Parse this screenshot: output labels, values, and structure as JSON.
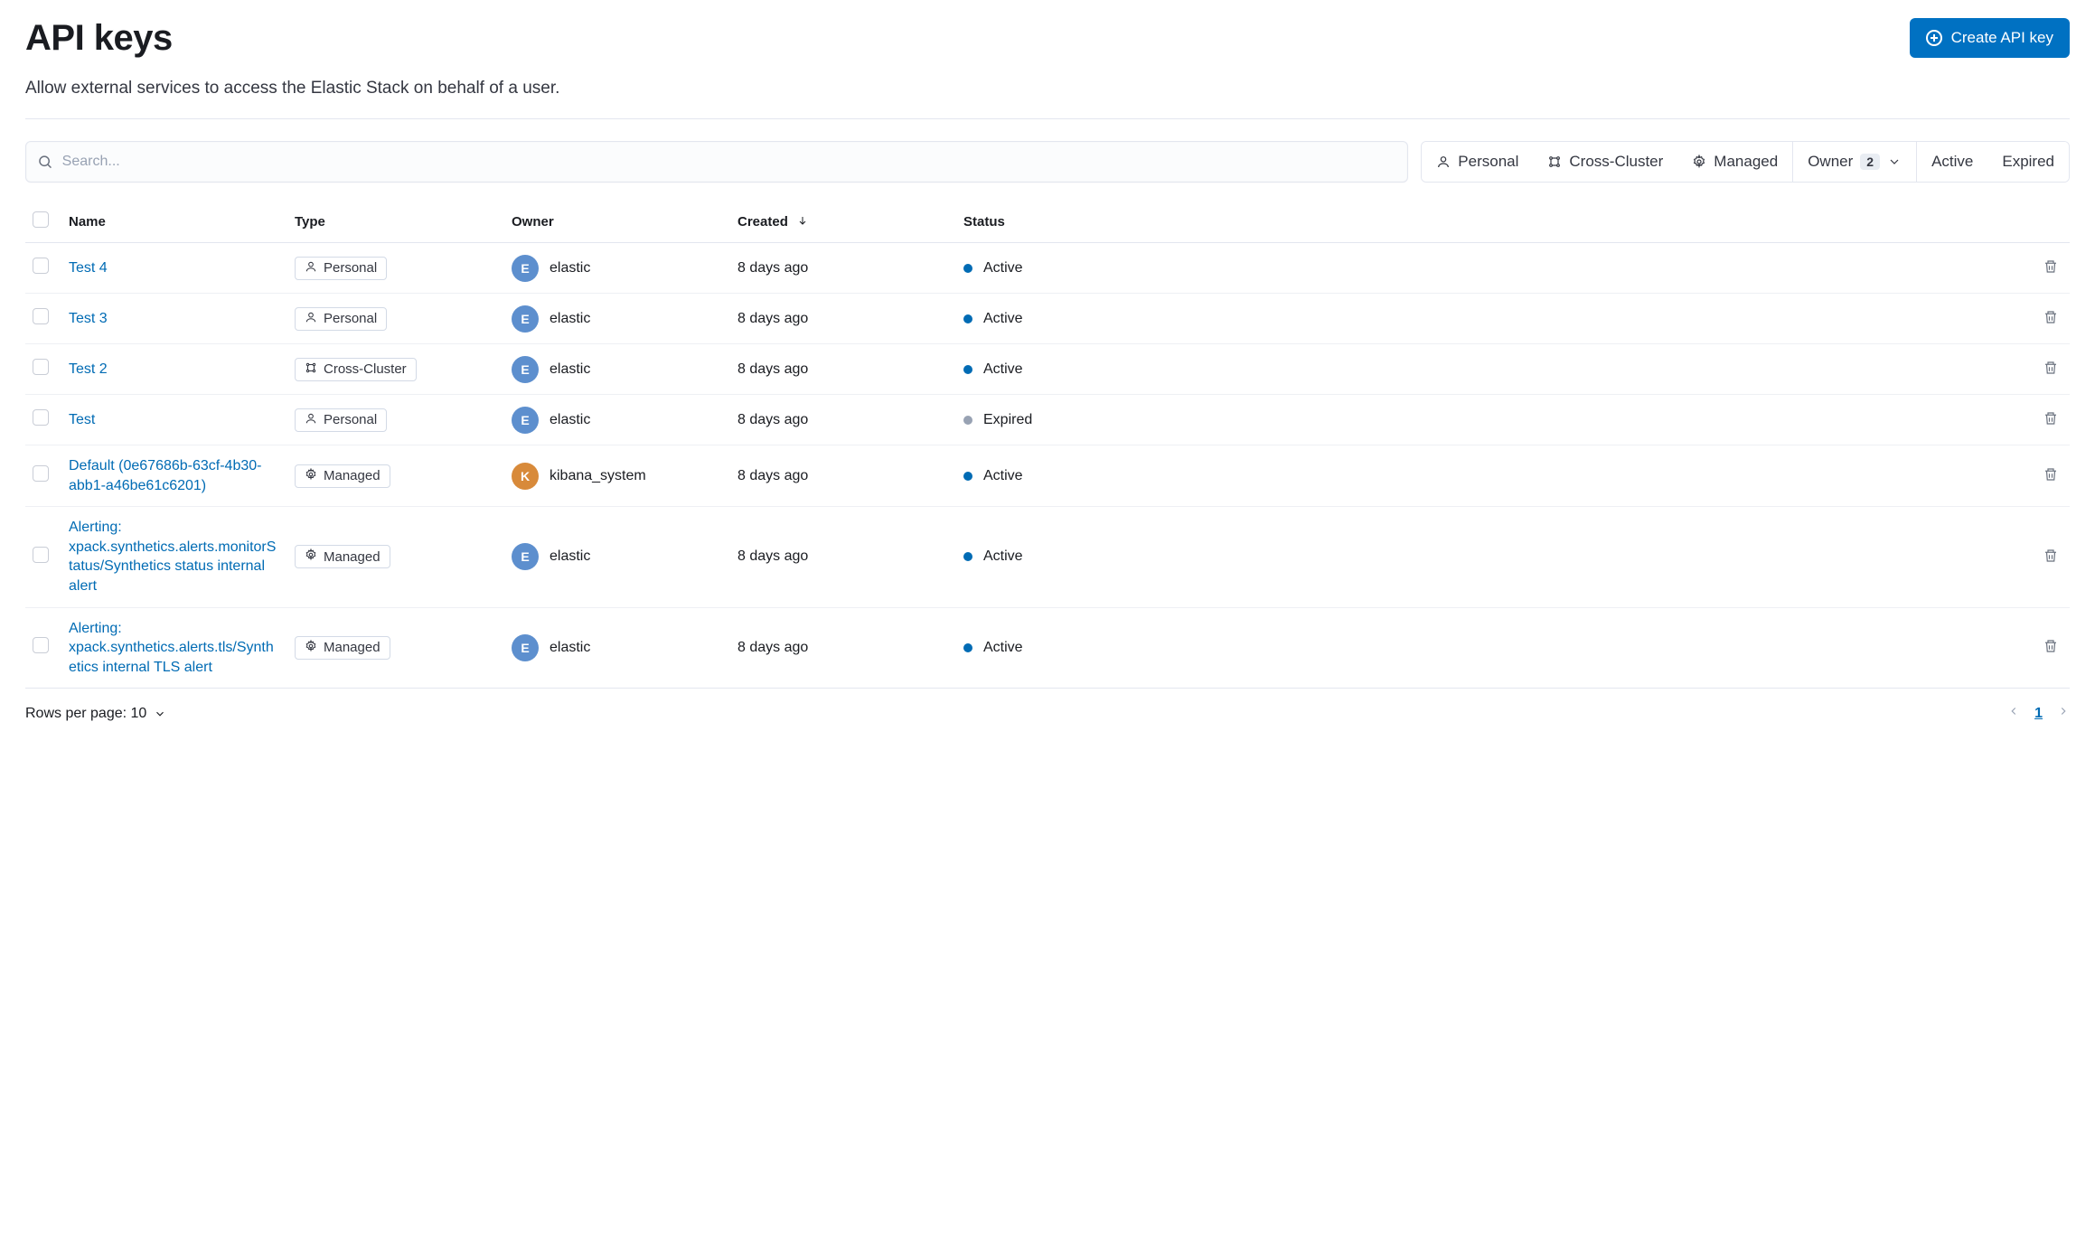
{
  "header": {
    "title": "API keys",
    "subtitle": "Allow external services to access the Elastic Stack on behalf of a user.",
    "create_button": "Create API key"
  },
  "search": {
    "placeholder": "Search..."
  },
  "filters": {
    "personal": "Personal",
    "cross_cluster": "Cross-Cluster",
    "managed": "Managed",
    "owner_label": "Owner",
    "owner_count": "2",
    "active": "Active",
    "expired": "Expired"
  },
  "table": {
    "columns": {
      "name": "Name",
      "type": "Type",
      "owner": "Owner",
      "created": "Created",
      "status": "Status"
    },
    "rows": [
      {
        "name": "Test 4",
        "type": "Personal",
        "owner": "elastic",
        "owner_initial": "E",
        "owner_color": "blue",
        "created": "8 days ago",
        "status": "Active"
      },
      {
        "name": "Test 3",
        "type": "Personal",
        "owner": "elastic",
        "owner_initial": "E",
        "owner_color": "blue",
        "created": "8 days ago",
        "status": "Active"
      },
      {
        "name": "Test 2",
        "type": "Cross-Cluster",
        "owner": "elastic",
        "owner_initial": "E",
        "owner_color": "blue",
        "created": "8 days ago",
        "status": "Active"
      },
      {
        "name": "Test",
        "type": "Personal",
        "owner": "elastic",
        "owner_initial": "E",
        "owner_color": "blue",
        "created": "8 days ago",
        "status": "Expired"
      },
      {
        "name": "Default (0e67686b-63cf-4b30-abb1-a46be61c6201)",
        "type": "Managed",
        "owner": "kibana_system",
        "owner_initial": "K",
        "owner_color": "orange",
        "created": "8 days ago",
        "status": "Active"
      },
      {
        "name": "Alerting: xpack.synthetics.alerts.monitorStatus/Synthetics status internal alert",
        "type": "Managed",
        "owner": "elastic",
        "owner_initial": "E",
        "owner_color": "blue",
        "created": "8 days ago",
        "status": "Active"
      },
      {
        "name": "Alerting: xpack.synthetics.alerts.tls/Synthetics internal TLS alert",
        "type": "Managed",
        "owner": "elastic",
        "owner_initial": "E",
        "owner_color": "blue",
        "created": "8 days ago",
        "status": "Active"
      }
    ]
  },
  "footer": {
    "rows_per_page_label": "Rows per page: 10",
    "current_page": "1"
  }
}
